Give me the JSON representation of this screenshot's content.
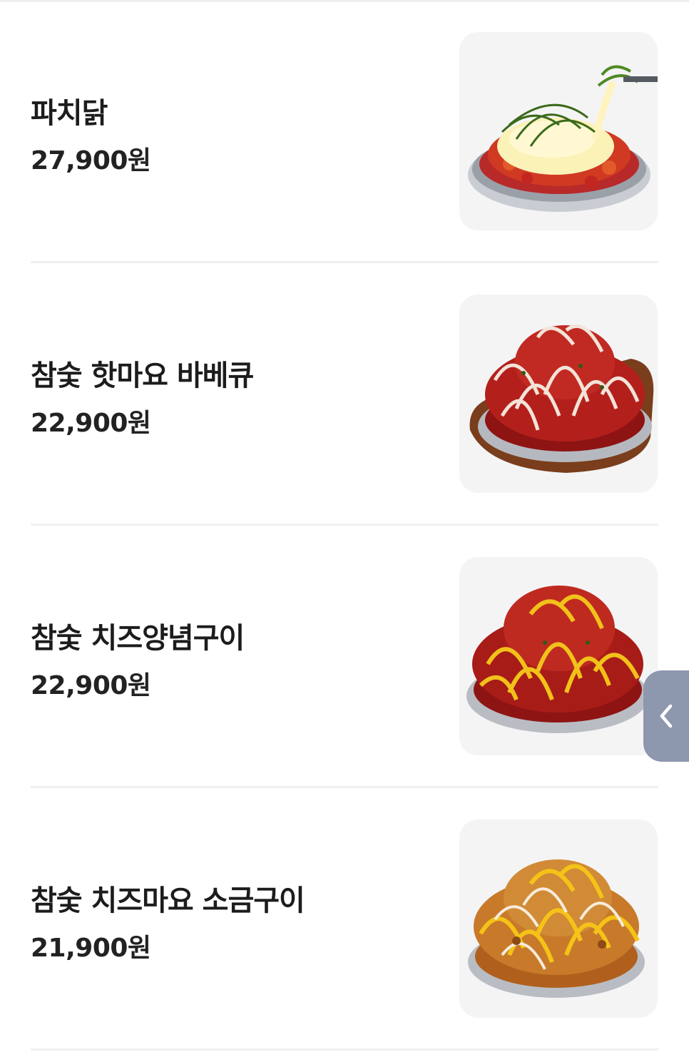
{
  "menu": {
    "items": [
      {
        "name": "파치닭",
        "price": "27,900원",
        "image_icon": "food-photo-pachi-chicken-icon"
      },
      {
        "name": "참숯 핫마요 바베큐",
        "price": "22,900원",
        "image_icon": "food-photo-hot-mayo-bbq-icon"
      },
      {
        "name": "참숯 치즈양념구이",
        "price": "22,900원",
        "image_icon": "food-photo-cheese-yangnyeom-icon"
      },
      {
        "name": "참숯 치즈마요 소금구이",
        "price": "21,900원",
        "image_icon": "food-photo-cheese-mayo-salt-icon"
      }
    ]
  },
  "side_tab": {
    "icon": "chevron-left-icon",
    "color": "#8d97ae"
  },
  "colors": {
    "thumb_bg": "#f4f4f5",
    "text": "#1c1c1c",
    "divider": "#f0f0f0"
  }
}
